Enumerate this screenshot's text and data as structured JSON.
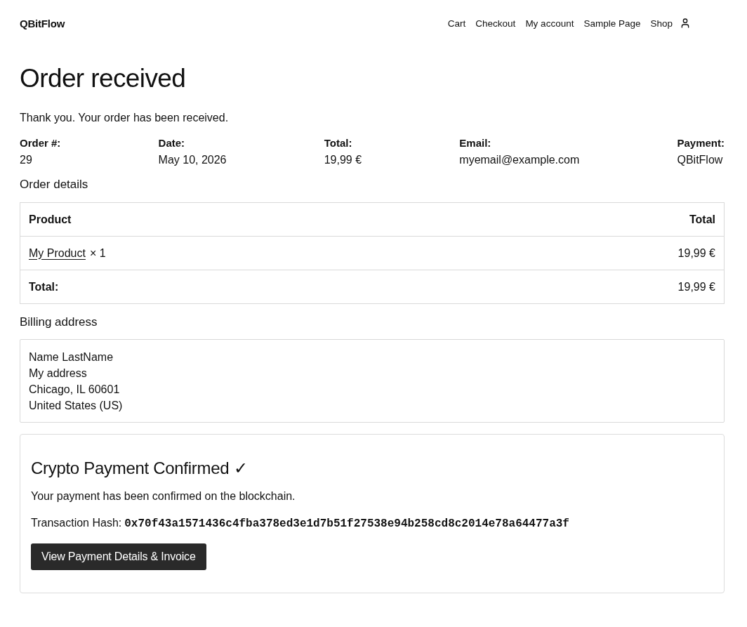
{
  "header": {
    "logo": "QBitFlow",
    "nav": [
      {
        "label": "Cart"
      },
      {
        "label": "Checkout"
      },
      {
        "label": "My account"
      },
      {
        "label": "Sample Page"
      },
      {
        "label": "Shop"
      }
    ]
  },
  "page": {
    "title": "Order received",
    "notice": "Thank you. Your order has been received."
  },
  "overview": [
    {
      "label": "Order #:",
      "value": "29"
    },
    {
      "label": "Date:",
      "value": "May 10, 2026"
    },
    {
      "label": "Total:",
      "value": "19,99 €"
    },
    {
      "label": "Email:",
      "value": "myemail@example.com"
    },
    {
      "label": "Payment:",
      "value": "QBitFlow"
    }
  ],
  "order_details": {
    "heading": "Order details",
    "columns": [
      "Product",
      "Total"
    ],
    "rows": [
      {
        "product": "My Product",
        "quantity": "× 1",
        "total": "19,99 €"
      }
    ],
    "footer": [
      {
        "label": "Total:",
        "value": "19,99 €"
      }
    ]
  },
  "billing_address": {
    "heading": "Billing address",
    "lines": [
      "Name LastName",
      "My address",
      "Chicago, IL 60601",
      "United States (US)"
    ]
  },
  "payment_card": {
    "heading": "Crypto Payment Confirmed ✓",
    "message": "Your payment has been confirmed on the blockchain.",
    "hash_label": "Transaction Hash:",
    "hash": "0x70f43a1571436c4fba378ed3e1d7b51f27538e94b258cd8c2014e78a64477a3f",
    "button": "View Payment Details & Invoice"
  }
}
